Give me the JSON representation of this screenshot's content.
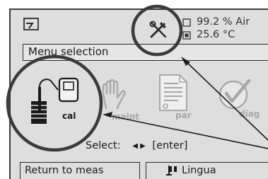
{
  "status": {
    "reading_1": "99.2 % Air",
    "reading_2": "25.6 °C"
  },
  "menu": {
    "title": "Menu selection"
  },
  "menu_items": {
    "cal": "cal",
    "maint": "maint",
    "par": "par",
    "diag": "diag"
  },
  "select": {
    "label": "Select:",
    "arrows": "◀ ▶",
    "enter": "[enter]"
  },
  "softkeys": {
    "left": "Return to meas",
    "right": "Lingua"
  },
  "colors": {
    "screen_bg": "#dedede",
    "foreground": "#1a1a1a",
    "inactive_icon": "#a8a8a8"
  }
}
